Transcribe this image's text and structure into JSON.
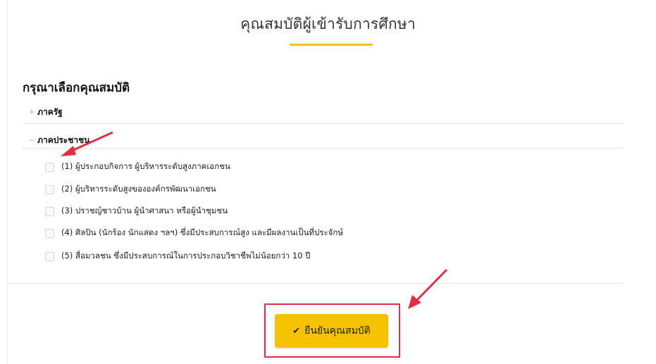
{
  "page": {
    "title": "คุณสมบัติผู้เข้ารับการศึกษา",
    "section_heading": "กรุณาเลือกคุณสมบัติ"
  },
  "groups": [
    {
      "toggle": "+",
      "label": "ภาครัฐ"
    },
    {
      "toggle": "−",
      "label": "ภาคประชาชน"
    }
  ],
  "options": [
    {
      "label": "(1) ผู้ประกอบกิจการ ผู้บริหารระดับสูงภาคเอกชน",
      "checked": false
    },
    {
      "label": "(2) ผู้บริหารระดับสูงขององค์กรพัฒนาเอกชน",
      "checked": false
    },
    {
      "label": "(3) ปราชญ์ชาวบ้าน ผู้นำศาสนา หรือผู้นำชุมชน",
      "checked": false
    },
    {
      "label": "(4) ศิลปิน (นักร้อง นักแสดง ฯลฯ) ซึ่งมีประสบการณ์สูง และมีผลงานเป็นที่ประจักษ์",
      "checked": false
    },
    {
      "label": "(5) สื่อมวลชน ซึ่งมีประสบการณ์ในการประกอบวิชาชีพไม่น้อยกว่า 10 ปี",
      "checked": false
    }
  ],
  "confirm": {
    "icon": "check-icon",
    "label": "ยืนยันคุณสมบัติ"
  },
  "colors": {
    "accent": "#f5c200",
    "annotation": "#e02f45"
  }
}
